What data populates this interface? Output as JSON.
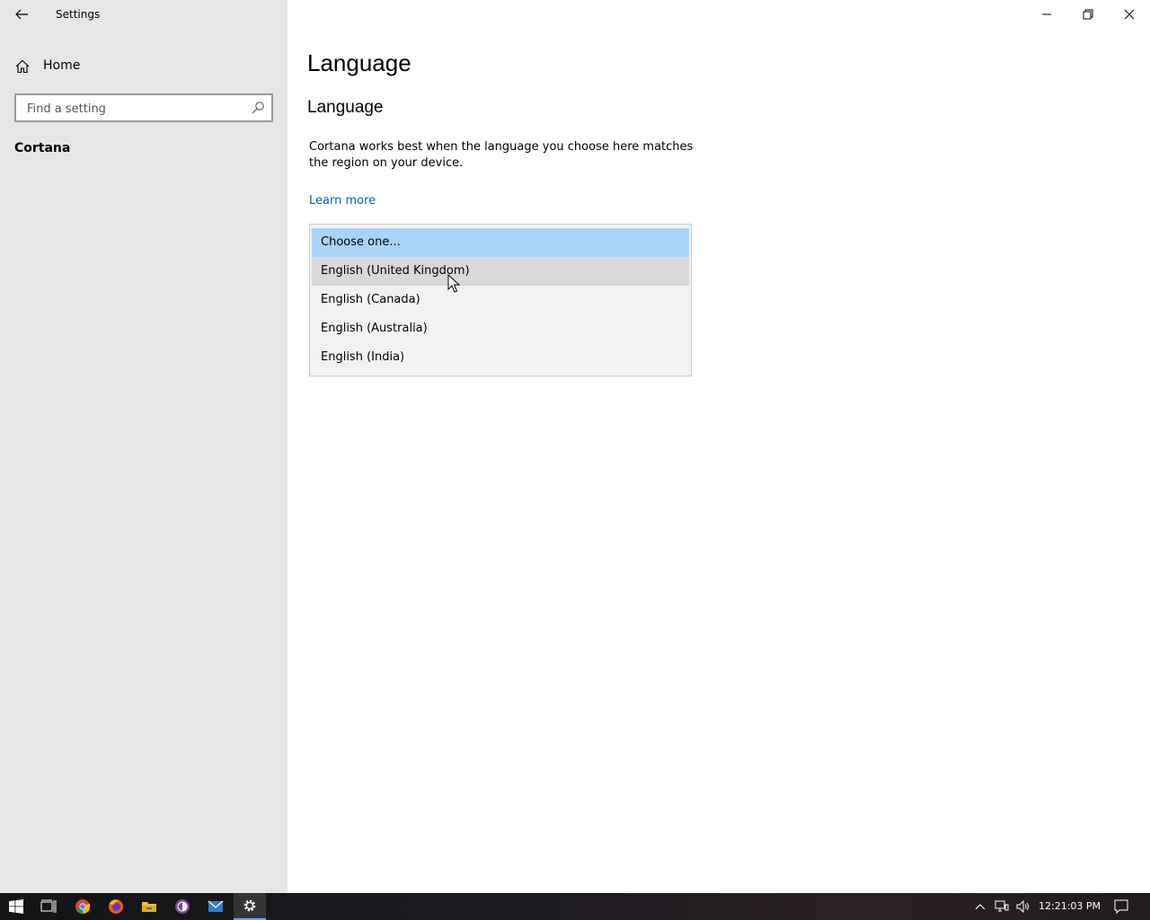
{
  "window": {
    "app_title": "Settings",
    "controls": {
      "minimize": "minimize-icon",
      "restore": "restore-icon",
      "close": "close-icon"
    }
  },
  "sidebar": {
    "back_icon": "back-arrow-icon",
    "home_label": "Home",
    "search_placeholder": "Find a setting",
    "section_label": "Cortana"
  },
  "main": {
    "page_title": "Language",
    "section_title": "Language",
    "description": "Cortana works best when the language you choose here matches the region on your device.",
    "learn_more": "Learn more",
    "dropdown": {
      "options": [
        "Choose one...",
        "English (United Kingdom)",
        "English (Canada)",
        "English (Australia)",
        "English (India)"
      ],
      "selected_index": 0,
      "hover_index": 1
    }
  },
  "taskbar": {
    "apps": [
      "start-icon",
      "task-view-icon",
      "chrome-icon",
      "firefox-icon",
      "file-explorer-icon",
      "tor-icon",
      "mail-icon",
      "settings-icon"
    ],
    "tray": [
      "show-hidden-icons",
      "network-icon",
      "volume-icon",
      "notifications-icon"
    ],
    "clock": "12:21:03 PM"
  },
  "colors": {
    "sidebar_bg": "#e6e6e6",
    "accent_link": "#0063b1",
    "selected_option": "#a9d3f7",
    "hover_option": "#d8d8d8"
  }
}
